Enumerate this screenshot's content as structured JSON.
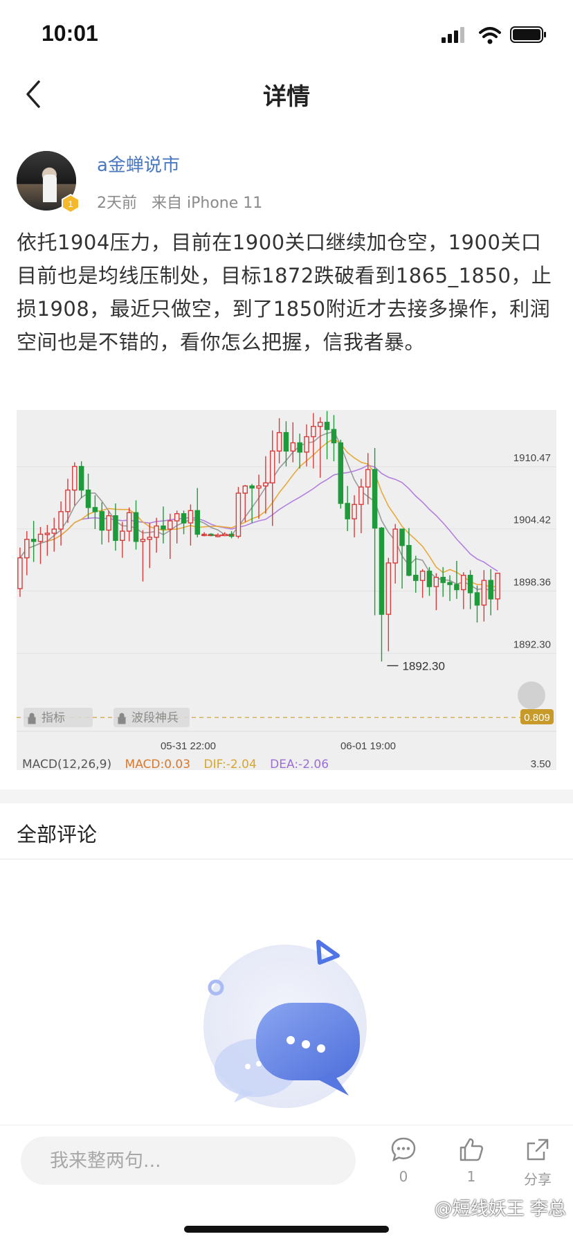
{
  "status_bar": {
    "time": "10:01",
    "icons": [
      "signal-icon",
      "wifi-icon",
      "battery-icon"
    ]
  },
  "nav": {
    "back_icon": "chevron-left-icon",
    "title": "详情"
  },
  "author": {
    "name": "a金蝉说市",
    "level": "1",
    "time_ago": "2天前",
    "source": "来自 iPhone 11"
  },
  "post": {
    "text": "依托1904压力，目前在1900关口继续加仓空，1900关口目前也是均线压制处，目标1872跌破看到1865_1850，止损1908，最近只做空，到了1850附近才去接多操作，利润空间也是不错的，看你怎么把握，信我者暴。"
  },
  "chart_data": {
    "type": "candlestick",
    "x_ticks": [
      "05-31 22:00",
      "06-01 19:00"
    ],
    "y_ticks": [
      1910.47,
      1904.42,
      1898.36,
      1892.3
    ],
    "annotation_low": "1892.30",
    "overlay_badges": [
      "指标",
      "波段神兵"
    ],
    "right_badge": "0.809",
    "macd": {
      "label": "MACD(12,26,9)",
      "macd": "MACD:0.03",
      "dif": "DIF:-2.04",
      "dea": "DEA:-2.06",
      "right_value": "3.50"
    },
    "ohlc": [
      [
        1898.6,
        1902.6,
        1897.8,
        1901.6
      ],
      [
        1901.6,
        1904.2,
        1899.9,
        1903.4
      ],
      [
        1903.4,
        1905.2,
        1901.2,
        1903.2
      ],
      [
        1903.2,
        1904.6,
        1901.0,
        1903.9
      ],
      [
        1903.9,
        1904.8,
        1901.8,
        1904.0
      ],
      [
        1904.0,
        1905.5,
        1902.2,
        1904.4
      ],
      [
        1904.4,
        1907.1,
        1902.8,
        1906.1
      ],
      [
        1906.1,
        1909.3,
        1905.0,
        1908.2
      ],
      [
        1908.2,
        1910.9,
        1906.7,
        1910.5
      ],
      [
        1910.5,
        1911.0,
        1907.4,
        1908.2
      ],
      [
        1908.2,
        1909.8,
        1905.4,
        1906.5
      ],
      [
        1906.5,
        1907.7,
        1904.4,
        1906.1
      ],
      [
        1906.1,
        1907.0,
        1902.9,
        1904.3
      ],
      [
        1904.3,
        1906.2,
        1903.1,
        1905.7
      ],
      [
        1905.7,
        1906.9,
        1902.3,
        1903.3
      ],
      [
        1903.3,
        1905.1,
        1901.6,
        1904.2
      ],
      [
        1904.2,
        1906.5,
        1903.2,
        1906.0
      ],
      [
        1906.0,
        1907.2,
        1902.4,
        1903.2
      ],
      [
        1903.2,
        1904.3,
        1899.3,
        1903.4
      ],
      [
        1903.4,
        1905.0,
        1900.6,
        1903.6
      ],
      [
        1903.6,
        1905.5,
        1902.1,
        1904.7
      ],
      [
        1904.7,
        1906.6,
        1903.0,
        1904.4
      ],
      [
        1904.4,
        1905.9,
        1901.5,
        1905.2
      ],
      [
        1905.2,
        1906.2,
        1903.0,
        1905.9
      ],
      [
        1905.9,
        1906.2,
        1903.9,
        1905.0
      ],
      [
        1905.0,
        1906.8,
        1902.8,
        1906.2
      ],
      [
        1906.2,
        1908.4,
        1903.6,
        1903.9
      ],
      [
        1903.9,
        1904.1,
        1903.7,
        1903.9
      ],
      [
        1903.9,
        1904.0,
        1903.7,
        1903.8
      ],
      [
        1903.8,
        1904.0,
        1903.6,
        1903.8
      ],
      [
        1903.8,
        1904.1,
        1903.7,
        1903.9
      ],
      [
        1903.9,
        1904.2,
        1903.5,
        1903.7
      ],
      [
        1903.7,
        1908.5,
        1903.5,
        1907.9
      ],
      [
        1907.9,
        1908.7,
        1905.1,
        1908.6
      ],
      [
        1908.6,
        1908.8,
        1905.0,
        1908.4
      ],
      [
        1908.4,
        1909.7,
        1905.4,
        1908.6
      ],
      [
        1908.6,
        1911.5,
        1905.9,
        1908.9
      ],
      [
        1908.9,
        1914.0,
        1904.7,
        1912.0
      ],
      [
        1912.0,
        1915.2,
        1910.8,
        1913.8
      ],
      [
        1913.8,
        1914.9,
        1910.5,
        1912.0
      ],
      [
        1912.0,
        1914.8,
        1910.9,
        1912.8
      ],
      [
        1912.8,
        1913.7,
        1910.3,
        1911.9
      ],
      [
        1911.9,
        1914.6,
        1910.5,
        1913.4
      ],
      [
        1913.4,
        1915.7,
        1910.3,
        1914.4
      ],
      [
        1914.4,
        1915.3,
        1909.4,
        1914.8
      ],
      [
        1914.8,
        1915.9,
        1911.2,
        1914.1
      ],
      [
        1914.1,
        1915.5,
        1911.0,
        1912.8
      ],
      [
        1912.8,
        1913.1,
        1906.4,
        1906.9
      ],
      [
        1906.9,
        1908.6,
        1904.2,
        1905.4
      ],
      [
        1905.4,
        1907.7,
        1903.6,
        1906.8
      ],
      [
        1906.8,
        1909.3,
        1904.0,
        1908.5
      ],
      [
        1908.5,
        1911.8,
        1906.8,
        1910.2
      ],
      [
        1910.2,
        1912.3,
        1896.0,
        1904.5
      ],
      [
        1904.5,
        1904.6,
        1891.5,
        1896.1
      ],
      [
        1896.1,
        1901.6,
        1892.5,
        1901.1
      ],
      [
        1901.1,
        1904.9,
        1899.1,
        1904.4
      ],
      [
        1904.4,
        1903.3,
        1898.6,
        1902.8
      ],
      [
        1902.8,
        1904.5,
        1899.8,
        1899.9
      ],
      [
        1899.9,
        1901.8,
        1898.2,
        1899.4
      ],
      [
        1899.4,
        1900.5,
        1897.7,
        1900.3
      ],
      [
        1900.3,
        1900.7,
        1897.9,
        1898.8
      ],
      [
        1898.8,
        1900.1,
        1896.5,
        1899.7
      ],
      [
        1899.7,
        1900.7,
        1897.8,
        1899.2
      ],
      [
        1899.2,
        1899.9,
        1897.4,
        1899.0
      ],
      [
        1899.0,
        1901.3,
        1897.6,
        1898.5
      ],
      [
        1898.5,
        1900.2,
        1896.6,
        1899.9
      ],
      [
        1899.9,
        1900.4,
        1896.6,
        1898.2
      ],
      [
        1898.2,
        1898.9,
        1895.3,
        1897.0
      ],
      [
        1897.0,
        1900.4,
        1895.4,
        1899.4
      ],
      [
        1899.4,
        1900.5,
        1896.0,
        1897.6
      ],
      [
        1897.6,
        1900.1,
        1896.5,
        1900.1
      ]
    ]
  },
  "comments": {
    "title": "全部评论"
  },
  "bottom_bar": {
    "input_placeholder": "我来整两句...",
    "comment_count": "0",
    "like_count": "1",
    "share_label": "分享",
    "watermark": "@短线妖王 李总"
  }
}
